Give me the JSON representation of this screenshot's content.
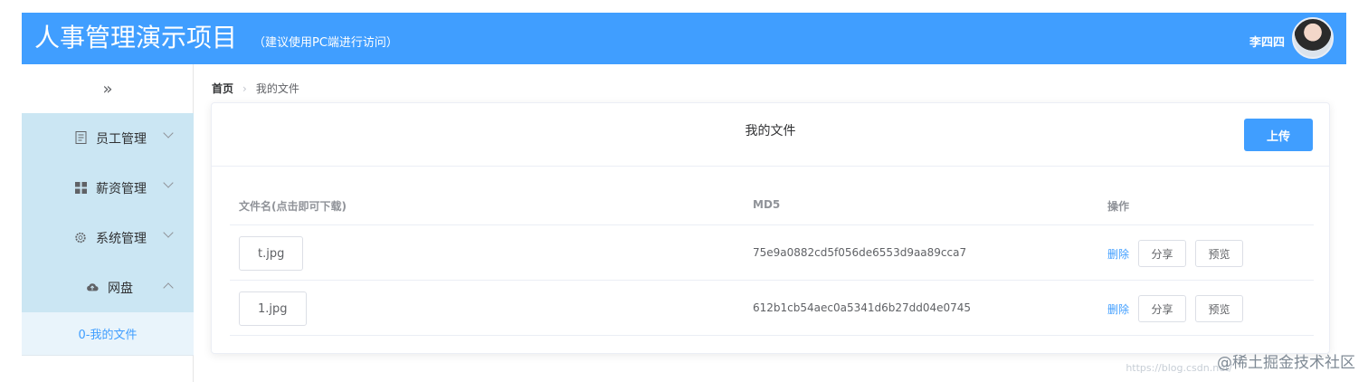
{
  "header": {
    "title": "人事管理演示项目",
    "subtitle": "（建议使用PC端进行访问）",
    "username": "李四四"
  },
  "sidebar": {
    "collapse_icon": "double-chevron-right-icon",
    "items": [
      {
        "label": "员工管理",
        "icon": "document-icon"
      },
      {
        "label": "薪资管理",
        "icon": "grid-icon"
      },
      {
        "label": "系统管理",
        "icon": "gear-icon"
      },
      {
        "label": "网盘",
        "icon": "cloud-icon"
      }
    ],
    "submenu_active": "0-我的文件"
  },
  "breadcrumb": {
    "home": "首页",
    "current": "我的文件"
  },
  "card": {
    "title": "我的文件",
    "upload_label": "上传"
  },
  "table": {
    "headers": [
      "文件名(点击即可下载)",
      "MD5",
      "操作"
    ],
    "rows": [
      {
        "filename": "t.jpg",
        "md5": "75e9a0882cd5f056de6553d9aa89cca7",
        "delete": "删除",
        "share": "分享",
        "preview": "预览"
      },
      {
        "filename": "1.jpg",
        "md5": "612b1cb54aec0a5341d6b27dd04e0745",
        "delete": "删除",
        "share": "分享",
        "preview": "预览"
      }
    ]
  },
  "watermark": "@稀土掘金技术社区",
  "watermark_url": "https://blog.csdn.net/",
  "colors": {
    "primary": "#409eff",
    "menu_bg": "#cbe6f3",
    "submenu_bg": "#e9f4fb"
  }
}
